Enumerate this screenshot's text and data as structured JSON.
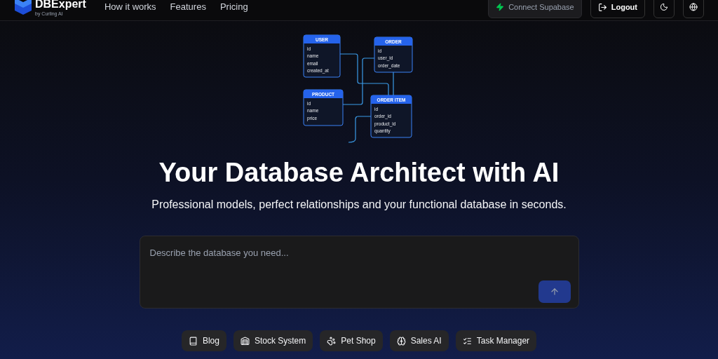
{
  "header": {
    "brand": "DBExpert",
    "brand_sub": "by Curling AI",
    "nav": [
      "How it works",
      "Features",
      "Pricing"
    ],
    "connect_button": "Connect Supabase",
    "logout_button": "Logout"
  },
  "diagram": {
    "tables": [
      {
        "name": "USER",
        "fields": [
          "id",
          "name",
          "email",
          "created_at"
        ]
      },
      {
        "name": "ORDER",
        "fields": [
          "id",
          "user_id",
          "order_date"
        ]
      },
      {
        "name": "PRODUCT",
        "fields": [
          "id",
          "name",
          "price"
        ]
      },
      {
        "name": "ORDER ITEM",
        "fields": [
          "id",
          "order_id",
          "product_id",
          "quantity"
        ]
      }
    ]
  },
  "hero": {
    "title": "Your Database Architect with AI",
    "subtitle": "Professional models, perfect relationships and your functional database in seconds."
  },
  "prompt": {
    "placeholder": "Describe the database you need..."
  },
  "examples": [
    {
      "kind": "book",
      "label": "Blog"
    },
    {
      "kind": "warehouse",
      "label": "Stock System"
    },
    {
      "kind": "paw",
      "label": "Pet Shop"
    },
    {
      "kind": "brain",
      "label": "Sales AI"
    },
    {
      "kind": "list",
      "label": "Task Manager"
    }
  ]
}
